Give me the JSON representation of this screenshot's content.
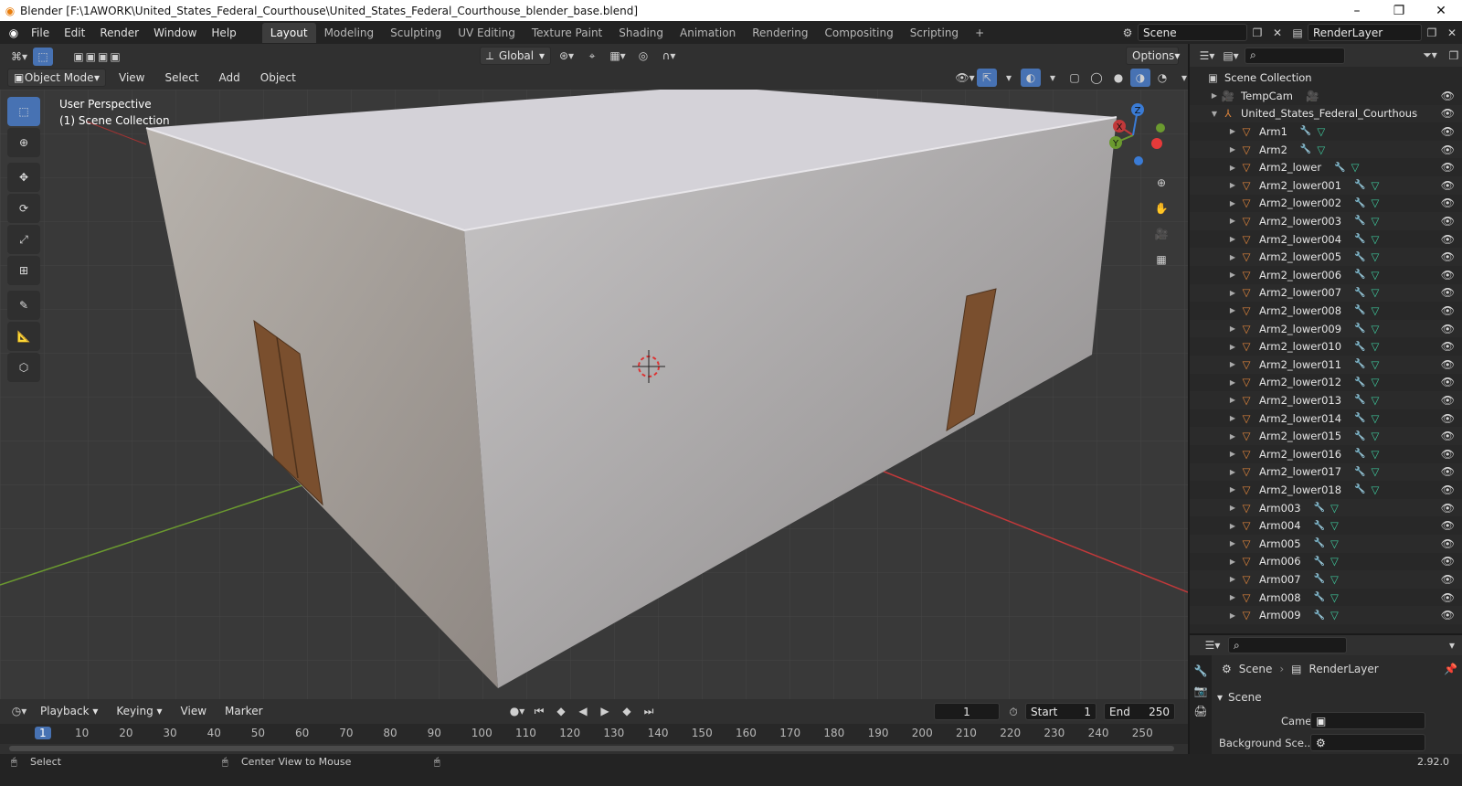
{
  "window": {
    "title": "Blender [F:\\1AWORK\\United_States_Federal_Courthouse\\United_States_Federal_Courthouse_blender_base.blend]",
    "minimize": "–",
    "maximize": "❐",
    "close": "✕"
  },
  "menu": [
    "File",
    "Edit",
    "Render",
    "Window",
    "Help"
  ],
  "workspaces": [
    "Layout",
    "Modeling",
    "Sculpting",
    "UV Editing",
    "Texture Paint",
    "Shading",
    "Animation",
    "Rendering",
    "Compositing",
    "Scripting",
    "+"
  ],
  "scene_field": "Scene",
  "renderlayer_field": "RenderLayer",
  "viewport_header": {
    "transform_orientation": "Global",
    "options": "Options",
    "mode": "Object Mode",
    "menus": [
      "View",
      "Select",
      "Add",
      "Object"
    ]
  },
  "viewport": {
    "perspective_label": "User Perspective",
    "collection_label": "(1) Scene Collection",
    "gizmo": {
      "x": "X",
      "y": "Y",
      "z": "Z"
    }
  },
  "colors": {
    "accent": "#4772b3",
    "grid_bg": "#393939",
    "x_axis": "#c0393a",
    "y_axis": "#6b9a2f",
    "mesh_icon": "#e0853b",
    "modifier_icon": "#6fa6e0",
    "vertex_icon": "#3ec79b"
  },
  "outliner": {
    "root": "Scene Collection",
    "items": [
      {
        "name": "TempCam",
        "indent": 1,
        "icons": [
          "camera"
        ]
      },
      {
        "name": "United_States_Federal_Courthous",
        "indent": 1,
        "icons": [],
        "expanded": true
      },
      {
        "name": "Arm1",
        "indent": 2,
        "icons": [
          "wrench",
          "mesh"
        ]
      },
      {
        "name": "Arm2",
        "indent": 2,
        "icons": [
          "wrench",
          "mesh"
        ]
      },
      {
        "name": "Arm2_lower",
        "indent": 2,
        "icons": [
          "wrench",
          "mesh"
        ]
      },
      {
        "name": "Arm2_lower001",
        "indent": 2,
        "icons": [
          "wrench",
          "mesh"
        ]
      },
      {
        "name": "Arm2_lower002",
        "indent": 2,
        "icons": [
          "wrench",
          "mesh"
        ]
      },
      {
        "name": "Arm2_lower003",
        "indent": 2,
        "icons": [
          "wrench",
          "mesh"
        ]
      },
      {
        "name": "Arm2_lower004",
        "indent": 2,
        "icons": [
          "wrench",
          "mesh"
        ]
      },
      {
        "name": "Arm2_lower005",
        "indent": 2,
        "icons": [
          "wrench",
          "mesh"
        ]
      },
      {
        "name": "Arm2_lower006",
        "indent": 2,
        "icons": [
          "wrench",
          "mesh"
        ]
      },
      {
        "name": "Arm2_lower007",
        "indent": 2,
        "icons": [
          "wrench",
          "mesh"
        ]
      },
      {
        "name": "Arm2_lower008",
        "indent": 2,
        "icons": [
          "wrench",
          "mesh"
        ]
      },
      {
        "name": "Arm2_lower009",
        "indent": 2,
        "icons": [
          "wrench",
          "mesh"
        ]
      },
      {
        "name": "Arm2_lower010",
        "indent": 2,
        "icons": [
          "wrench",
          "mesh"
        ]
      },
      {
        "name": "Arm2_lower011",
        "indent": 2,
        "icons": [
          "wrench",
          "mesh"
        ]
      },
      {
        "name": "Arm2_lower012",
        "indent": 2,
        "icons": [
          "wrench",
          "mesh"
        ]
      },
      {
        "name": "Arm2_lower013",
        "indent": 2,
        "icons": [
          "wrench",
          "mesh"
        ]
      },
      {
        "name": "Arm2_lower014",
        "indent": 2,
        "icons": [
          "wrench",
          "mesh"
        ]
      },
      {
        "name": "Arm2_lower015",
        "indent": 2,
        "icons": [
          "wrench",
          "mesh"
        ]
      },
      {
        "name": "Arm2_lower016",
        "indent": 2,
        "icons": [
          "wrench",
          "mesh"
        ]
      },
      {
        "name": "Arm2_lower017",
        "indent": 2,
        "icons": [
          "wrench",
          "mesh"
        ]
      },
      {
        "name": "Arm2_lower018",
        "indent": 2,
        "icons": [
          "wrench",
          "mesh"
        ]
      },
      {
        "name": "Arm003",
        "indent": 2,
        "icons": [
          "wrench",
          "mesh"
        ]
      },
      {
        "name": "Arm004",
        "indent": 2,
        "icons": [
          "wrench",
          "mesh"
        ]
      },
      {
        "name": "Arm005",
        "indent": 2,
        "icons": [
          "wrench",
          "mesh"
        ]
      },
      {
        "name": "Arm006",
        "indent": 2,
        "icons": [
          "wrench",
          "mesh"
        ]
      },
      {
        "name": "Arm007",
        "indent": 2,
        "icons": [
          "wrench",
          "mesh"
        ]
      },
      {
        "name": "Arm008",
        "indent": 2,
        "icons": [
          "wrench",
          "mesh"
        ]
      },
      {
        "name": "Arm009",
        "indent": 2,
        "icons": [
          "wrench",
          "mesh"
        ]
      }
    ]
  },
  "properties": {
    "breadcrumb_scene": "Scene",
    "breadcrumb_layer": "RenderLayer",
    "panel_title": "Scene",
    "camera_label": "Camera",
    "background_label": "Background Sce..."
  },
  "timeline": {
    "menus": [
      "Playback",
      "Keying",
      "View",
      "Marker"
    ],
    "current_frame": "1",
    "start_label": "Start",
    "start": "1",
    "end_label": "End",
    "end": "250",
    "ruler": [
      "1",
      "10",
      "20",
      "30",
      "40",
      "50",
      "60",
      "70",
      "80",
      "90",
      "100",
      "110",
      "120",
      "130",
      "140",
      "150",
      "160",
      "170",
      "180",
      "190",
      "200",
      "210",
      "220",
      "230",
      "240",
      "250"
    ]
  },
  "statusbar": {
    "left": "Select",
    "middle": "Center View to Mouse",
    "version": "2.92.0"
  }
}
